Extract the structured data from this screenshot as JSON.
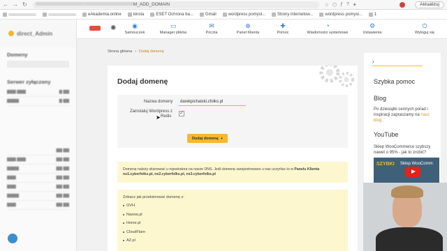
{
  "browser": {
    "url_prefix": "",
    "url_suffix": "M_ADD_DOMAIN",
    "update_label": "Aktualizuj",
    "bookmarks": [
      {
        "label": "eAkademia.online"
      },
      {
        "label": "kinsta"
      },
      {
        "label": "ESET Ochrona ba..."
      },
      {
        "label": "Gmail"
      },
      {
        "label": "wordpress pomysł..."
      },
      {
        "label": "Strony internetow..."
      },
      {
        "label": "wordpress pomysł..."
      },
      {
        "label": "1"
      }
    ]
  },
  "sidebar": {
    "domains_heading": "Domeny",
    "server_heading": "Serwer zyłączony"
  },
  "toolbar": {
    "items": [
      {
        "label": "Samouczek",
        "icon": "grad-cap-icon"
      },
      {
        "label": "Manager plików",
        "icon": "folder-icon"
      },
      {
        "label": "Poczta",
        "icon": "mail-icon"
      },
      {
        "label": "Panel Klienta",
        "icon": "user-icon"
      },
      {
        "label": "Pomoc",
        "icon": "help-icon"
      },
      {
        "label": "Wiadomości systemowe",
        "icon": "bell-icon"
      },
      {
        "label": "Ustawienia",
        "icon": "gear-icon"
      },
      {
        "label": "Wyloguj się",
        "icon": "logout-icon"
      }
    ]
  },
  "breadcrumb": {
    "home": "Strona główna",
    "sep": "›",
    "current": "Dodaj domenę"
  },
  "form": {
    "title": "Dodaj domenę",
    "domain_label": "Nazwa domeny",
    "domain_value": "darekpichalski.cfolks.pl",
    "wp_label_1": "Zainstaluj Wordpress z",
    "wp_label_2": "Redis",
    "wp_checked": "✓",
    "submit_label": "Dodaj domenę",
    "submit_icon": "+"
  },
  "dns_note": {
    "line1": "Domenę należy skierować u rejestratora na nasze DNS. Jeśli domenę zarejestrowano u nas uczyńisz to w",
    "panel_link": "Panelu Klienta",
    "line2": "ns1.cyberfolks.pl, ns2.cyberfolks.pl, ns3.cyberfolks.pl"
  },
  "redirect_note": {
    "lead": "Zobacz jak przekierować domenę z:",
    "items": [
      "OVH",
      "Nazwa.pl",
      "Home.pl",
      "CloudFlare",
      "AZ.pl"
    ]
  },
  "help": {
    "title": "Szybka pomoc",
    "blog_title": "Blog",
    "blog_text": "Po dziesiątki cennych porad i inspiracji zapraszamy na",
    "blog_link": "nasz blog.",
    "yt_title": "YouTube",
    "yt_text": "Sklep WooCommerce szybszy nawet o 95% - jak to zrobić?",
    "thumb_title": "SZYBKI",
    "thumb_label": "Sklep WooComm"
  }
}
